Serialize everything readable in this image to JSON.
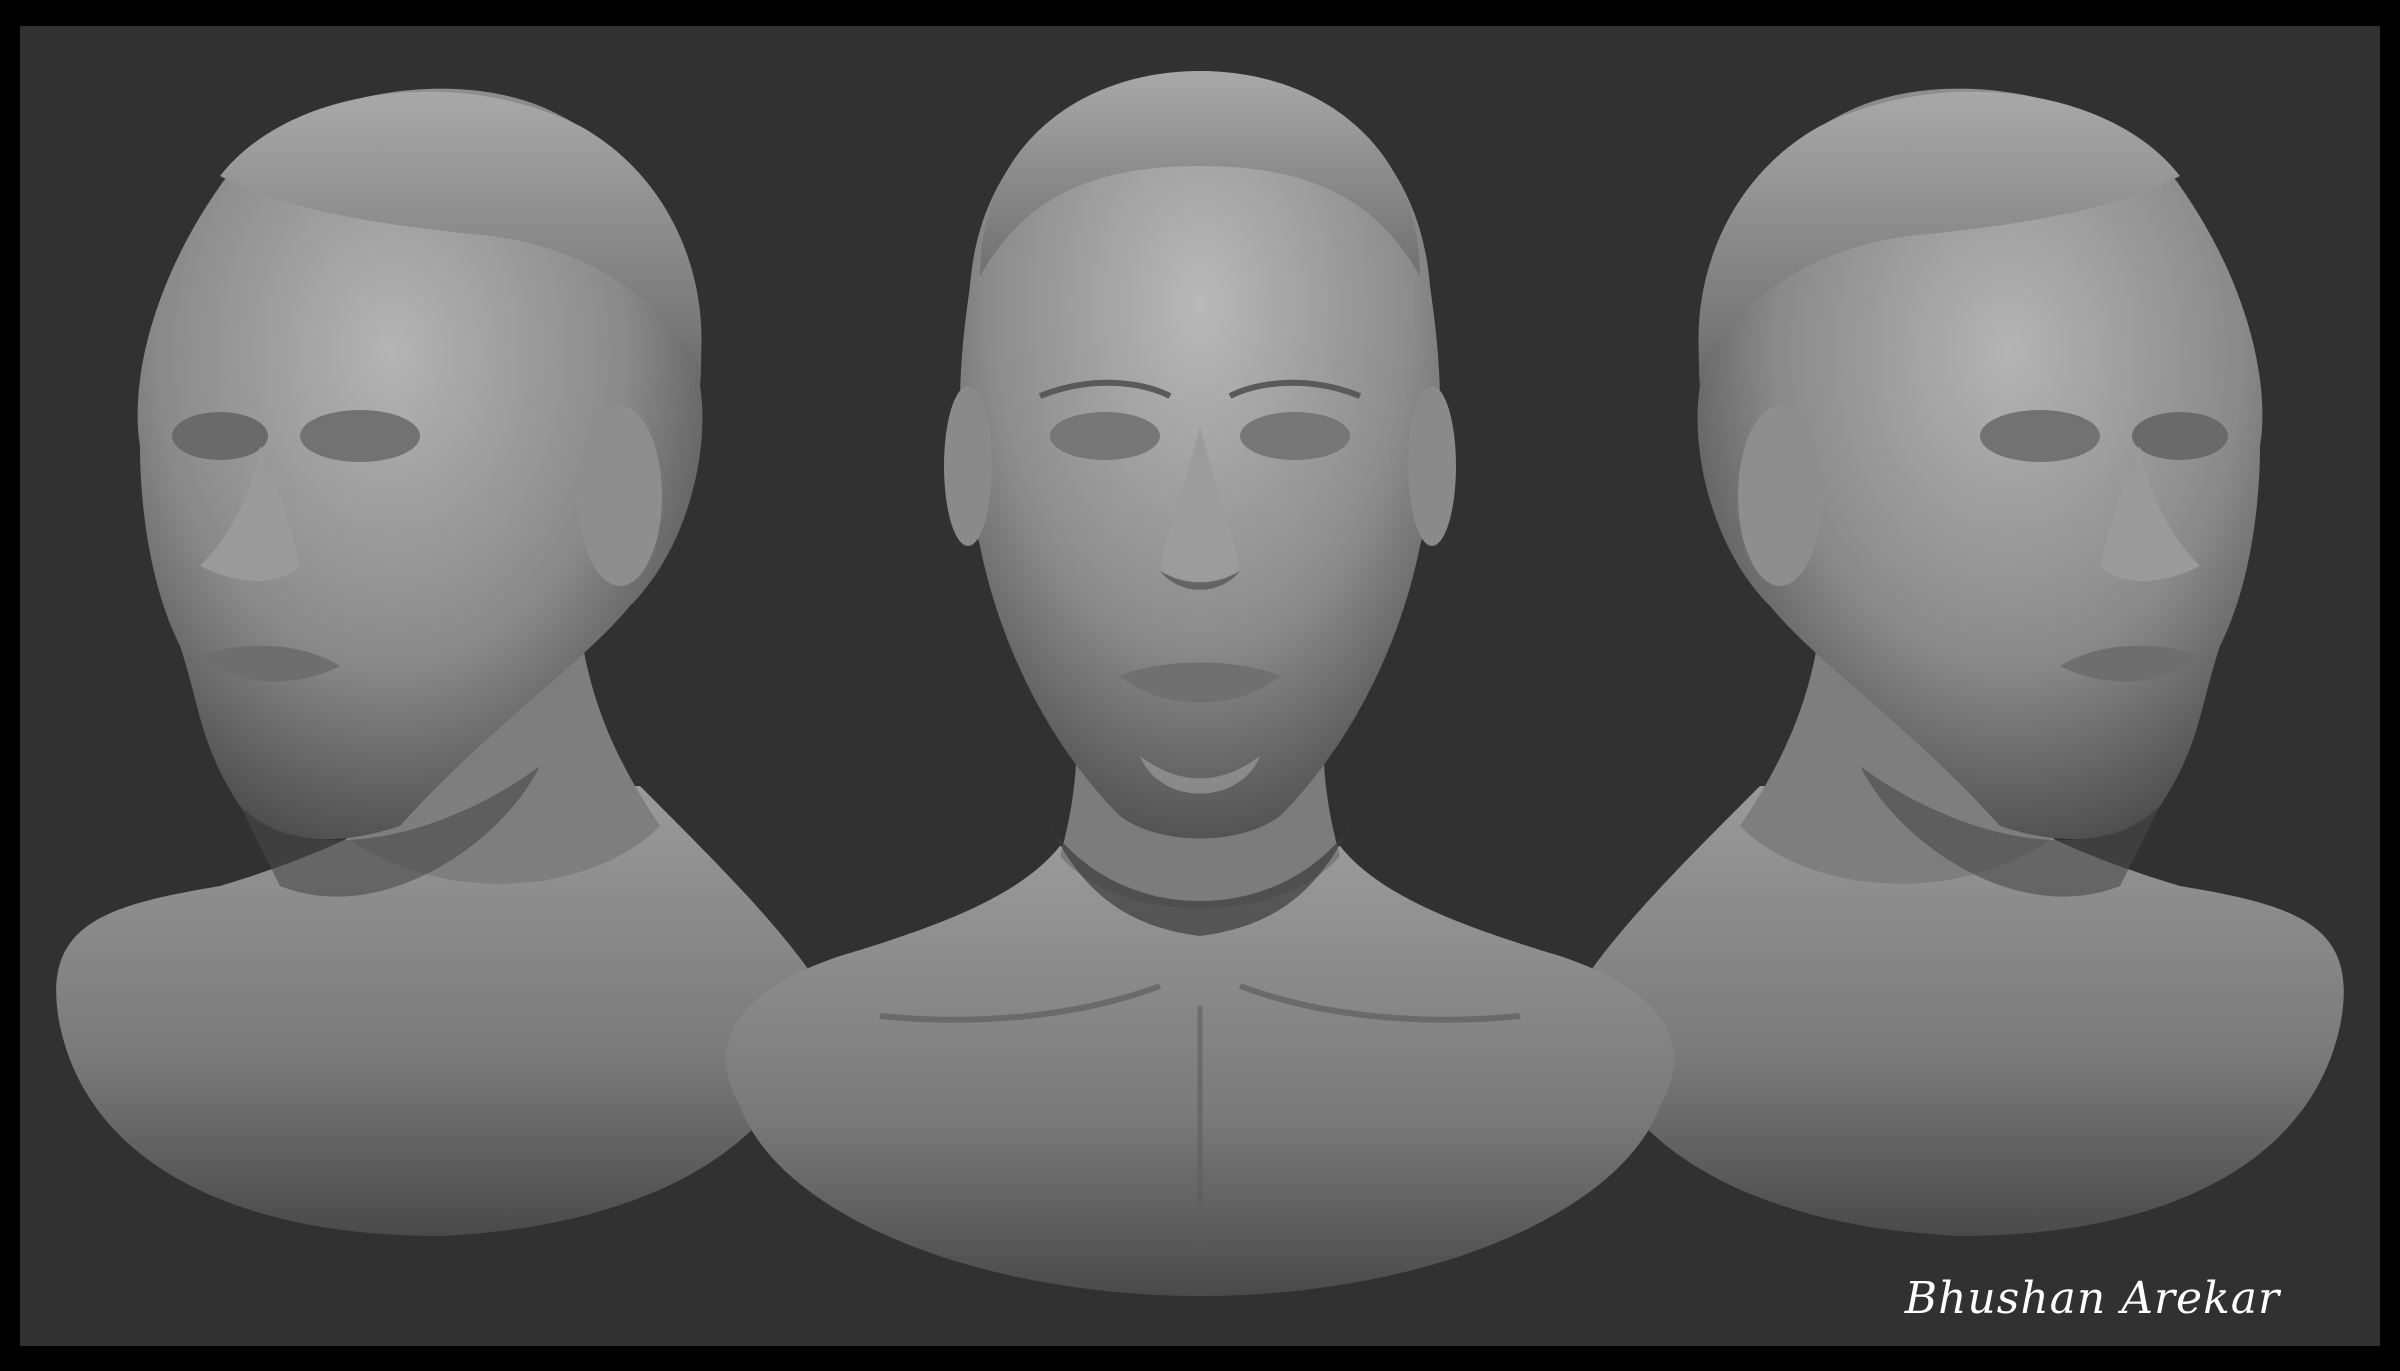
{
  "artwork": {
    "signature": "Bhushan Arekar",
    "views": [
      {
        "name": "three-quarter-left"
      },
      {
        "name": "front"
      },
      {
        "name": "three-quarter-right"
      }
    ]
  },
  "colors": {
    "border": "#000000",
    "background": "#313131",
    "clay": "#8a8a8a",
    "clay_highlight": "#b4b4b4",
    "clay_shadow": "#3c3c3c",
    "signature": "#ffffff"
  }
}
